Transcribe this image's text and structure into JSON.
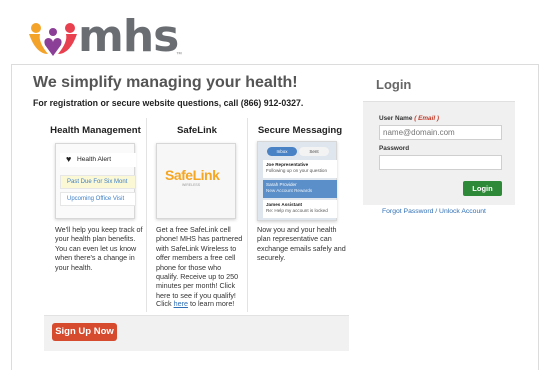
{
  "brand": {
    "name": "mhs",
    "trademark": "™"
  },
  "main": {
    "headline": "We simplify managing your health!",
    "subline": "For registration or secure website questions, call (866) 912-0327.",
    "columns": [
      {
        "title": "Health Management",
        "preview": {
          "alert_title": "Health Alert",
          "rows": [
            "Past Due For Six Mont",
            "Upcoming Office Visit"
          ]
        },
        "description": "We'll help you keep track of your health plan benefits. You can even let us know when there's a change in your health."
      },
      {
        "title": "SafeLink",
        "preview": {
          "logo_text": "SafeLink",
          "logo_sub": "WIRELESS"
        },
        "description": "Get a free SafeLink cell phone! MHS has partnered with SafeLink Wireless to offer members a free cell phone for those who qualify. Receive up to 250 minutes per month! Click here to see if you qualify!",
        "footer_prefix": "Click ",
        "footer_link": "here",
        "footer_suffix": " to learn more!"
      },
      {
        "title": "Secure Messaging",
        "preview": {
          "tabs": [
            "Inbox",
            "Sent"
          ],
          "messages": [
            {
              "from": "Joe Representative",
              "subject": "Following up on your question"
            },
            {
              "from": "Sarah Provider",
              "subject": "New Account Rewards"
            },
            {
              "from": "James Assistant",
              "subject": "Re: Help my account is locked"
            }
          ]
        },
        "description": "Now you and your health plan representative can exchange emails safely and securely."
      }
    ],
    "signup_label": "Sign Up Now"
  },
  "login": {
    "title": "Login",
    "username_label": "User Name",
    "username_hint": "( Email )",
    "username_placeholder": "name@domain.com",
    "password_label": "Password",
    "password_value": "",
    "button_label": "Login",
    "forgot_link": "Forgot Password / Unlock Account"
  },
  "colors": {
    "signup_button": "#d64a2e",
    "login_button": "#2e8a38",
    "link": "#2f6fb6",
    "brand_gray": "#6a6d72"
  }
}
